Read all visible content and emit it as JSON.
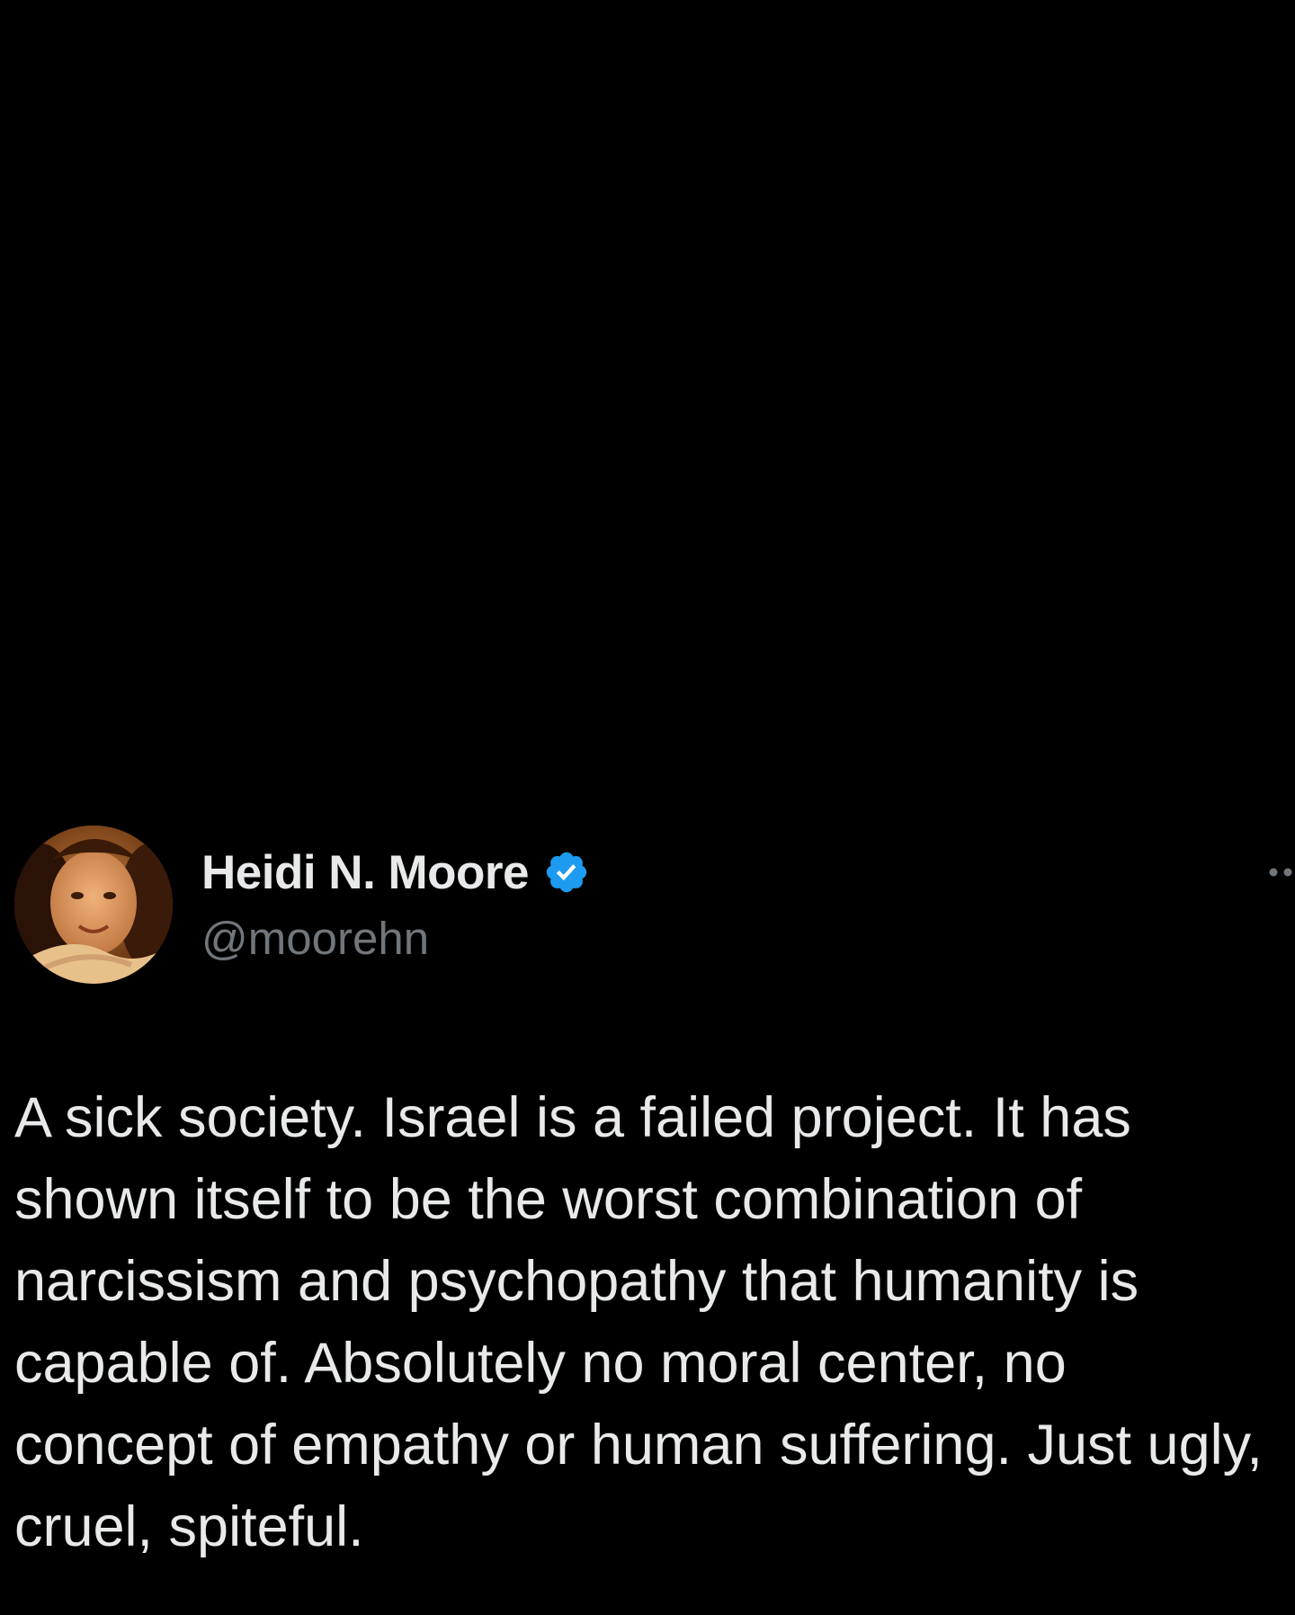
{
  "tweet": {
    "author": {
      "display_name": "Heidi N. Moore",
      "handle": "@moorehn",
      "verified": true,
      "verified_badge_icon": "verified-badge-icon",
      "avatar_icon": "avatar"
    },
    "more_options_icon": "more-horizontal-icon",
    "text": "A sick society. Israel is a failed project. It has shown itself to be the worst combination of narcissism and psychopathy that humanity is capable of. Absolutely no moral center, no concept of empathy or human suffering. Just ugly, cruel, spiteful."
  },
  "colors": {
    "background": "#000000",
    "primary_text": "#e7e9ea",
    "secondary_text": "#71767b",
    "verified_blue": "#1d9bf0"
  }
}
